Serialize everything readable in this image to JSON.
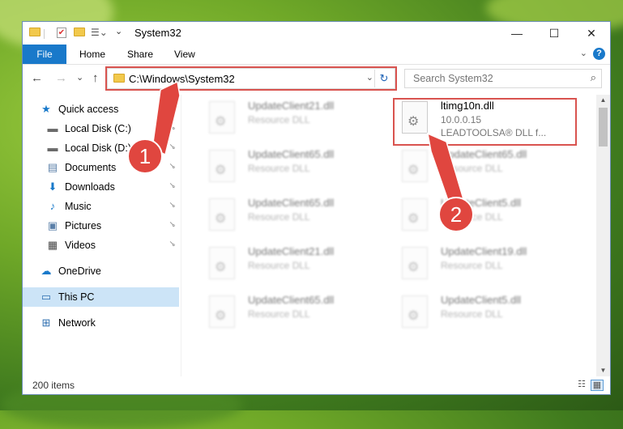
{
  "window": {
    "title": "System32",
    "controls": {
      "minimize": "—",
      "maximize": "☐",
      "close": "✕"
    }
  },
  "ribbon": {
    "tabs": [
      {
        "label": "File",
        "active": true
      },
      {
        "label": "Home"
      },
      {
        "label": "Share"
      },
      {
        "label": "View"
      }
    ],
    "help_label": "?",
    "expand_label": "⌄"
  },
  "nav": {
    "back_label": "←",
    "forward_label": "→",
    "recent_label": "⌄",
    "up_label": "↑",
    "address": "C:\\Windows\\System32",
    "address_dropdown": "⌄",
    "refresh_label": "↻",
    "search_placeholder": "Search System32",
    "search_icon": "⌕"
  },
  "sidebar": {
    "items": [
      {
        "label": "Quick access",
        "icon": "star-icon",
        "glyph": "★",
        "color": "#1979ca"
      },
      {
        "label": "Local Disk (C:)",
        "icon": "drive-icon",
        "glyph": "▬",
        "color": "#6a6a6a",
        "pinned": true
      },
      {
        "label": "Local Disk (D:)",
        "icon": "drive-icon",
        "glyph": "▬",
        "color": "#6a6a6a",
        "pinned": true
      },
      {
        "label": "Documents",
        "icon": "documents-icon",
        "glyph": "▤",
        "color": "#5a7fa8",
        "pinned": true
      },
      {
        "label": "Downloads",
        "icon": "downloads-icon",
        "glyph": "⬇",
        "color": "#1979ca",
        "pinned": true
      },
      {
        "label": "Music",
        "icon": "music-icon",
        "glyph": "♪",
        "color": "#1979ca",
        "pinned": true
      },
      {
        "label": "Pictures",
        "icon": "pictures-icon",
        "glyph": "▣",
        "color": "#5a7fa8",
        "pinned": true
      },
      {
        "label": "Videos",
        "icon": "videos-icon",
        "glyph": "▦",
        "color": "#444",
        "pinned": true
      },
      {
        "label": "OneDrive",
        "icon": "cloud-icon",
        "glyph": "☁",
        "color": "#1979ca"
      },
      {
        "label": "This PC",
        "icon": "computer-icon",
        "glyph": "▭",
        "color": "#2f6fb0",
        "selected": true
      },
      {
        "label": "Network",
        "icon": "network-icon",
        "glyph": "⊞",
        "color": "#2f6fb0"
      }
    ],
    "pin_glyph": "📌"
  },
  "files": [
    {
      "name": "UpdateClient21.dll",
      "type": "Resource DLL",
      "blurred": true
    },
    {
      "name": "ltimg10n.dll",
      "type": "10.0.0.15",
      "desc": "LEADTOOLSA® DLL f...",
      "blurred": false,
      "highlighted": true
    },
    {
      "name": "UpdateClient65.dll",
      "type": "Resource DLL",
      "blurred": true
    },
    {
      "name": "UpdateClient65.dll",
      "type": "Resource DLL",
      "blurred": true
    },
    {
      "name": "UpdateClient65.dll",
      "type": "Resource DLL",
      "blurred": true
    },
    {
      "name": "UpdateClient5.dll",
      "type": "Resource DLL",
      "blurred": true
    },
    {
      "name": "UpdateClient21.dll",
      "type": "Resource DLL",
      "blurred": true
    },
    {
      "name": "UpdateClient19.dll",
      "type": "Resource DLL",
      "blurred": true
    },
    {
      "name": "UpdateClient65.dll",
      "type": "Resource DLL",
      "blurred": true
    },
    {
      "name": "UpdateClient5.dll",
      "type": "Resource DLL",
      "blurred": true
    }
  ],
  "status": {
    "item_count": "200 items"
  },
  "annotations": [
    {
      "label": "1",
      "color": "#e0463f"
    },
    {
      "label": "2",
      "color": "#e0463f"
    }
  ]
}
